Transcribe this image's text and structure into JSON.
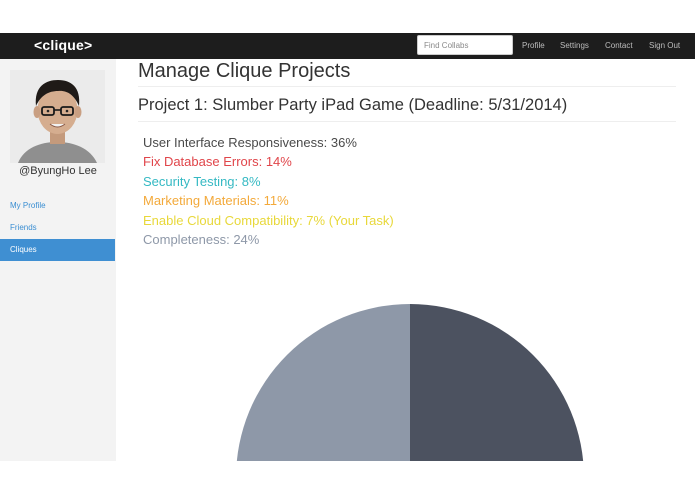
{
  "navbar": {
    "brand": "<clique>",
    "search_placeholder": "Find Collabs",
    "links": [
      "Profile",
      "Settings",
      "Contact",
      "Sign Out"
    ]
  },
  "sidebar": {
    "username": "@ByungHo Lee",
    "items": [
      {
        "label": "My Profile",
        "active": false
      },
      {
        "label": "Friends",
        "active": false
      },
      {
        "label": "Cliques",
        "active": true
      }
    ]
  },
  "main": {
    "page_title": "Manage Clique Projects",
    "project_title": "Project 1: Slumber Party iPad Game (Deadline: 5/31/2014)",
    "tasks": [
      {
        "text": "User Interface Responsiveness: 36%",
        "color": "#4a4a4a"
      },
      {
        "text": "Fix Database Errors: 14%",
        "color": "#e0454a"
      },
      {
        "text": "Security Testing: 8%",
        "color": "#35b9c3"
      },
      {
        "text": "Marketing Materials: 11%",
        "color": "#f3a93a"
      },
      {
        "text": "Enable Cloud Compatibility: 7% (Your Task)",
        "color": "#e8d83a"
      },
      {
        "text": "Completeness: 24%",
        "color": "#8e98a8"
      }
    ]
  },
  "chart_data": {
    "type": "pie",
    "slices": [
      {
        "label": "User Interface Responsiveness",
        "value": 36,
        "color": "#4c5260"
      },
      {
        "label": "Fix Database Errors",
        "value": 14,
        "color": "#e0454a"
      },
      {
        "label": "Security Testing",
        "value": 8,
        "color": "#35b9c3"
      },
      {
        "label": "Marketing Materials",
        "value": 11,
        "color": "#f3a93a"
      },
      {
        "label": "Enable Cloud Compatibility",
        "value": 7,
        "color": "#e8d83a"
      },
      {
        "label": "Completeness",
        "value": 24,
        "color": "#8e98a8"
      }
    ],
    "visible_slices": [
      {
        "label": "User Interface Responsiveness",
        "color": "#4c5260"
      },
      {
        "label": "Completeness",
        "color": "#8e98a8"
      }
    ]
  }
}
